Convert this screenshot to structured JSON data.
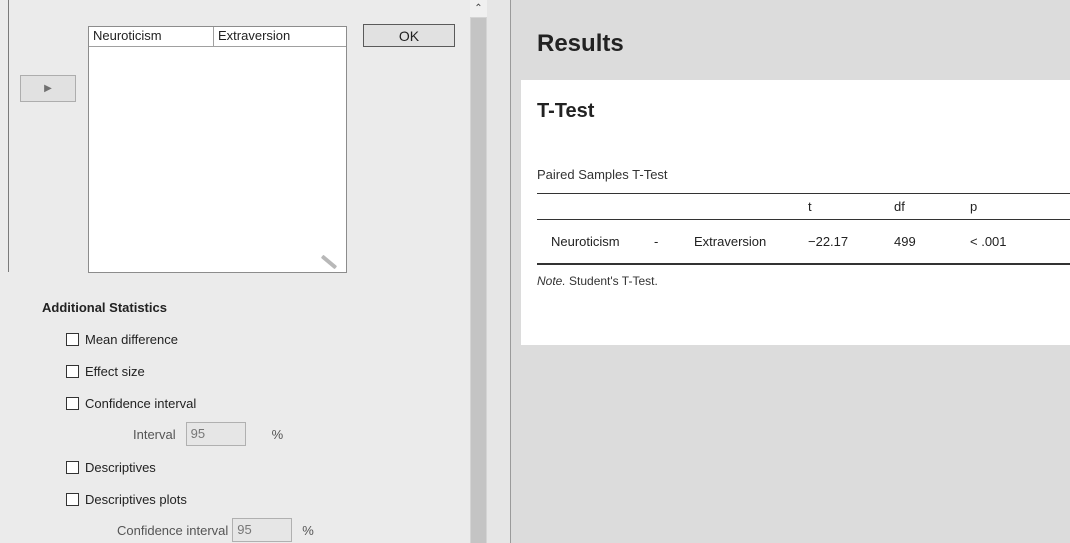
{
  "left_panel": {
    "move_button_icon": "triangle-right-icon",
    "pair_list": {
      "col1": "Neuroticism",
      "col2": "Extraversion"
    },
    "ok_label": "OK",
    "additional_statistics": {
      "title": "Additional Statistics",
      "options": {
        "mean_difference": "Mean difference",
        "effect_size": "Effect size",
        "confidence_interval": "Confidence interval",
        "descriptives": "Descriptives",
        "descriptives_plots": "Descriptives plots"
      },
      "interval_label": "Interval",
      "interval_value": "95",
      "interval_unit": "%",
      "plots_ci_label": "Confidence interval",
      "plots_ci_value": "95",
      "plots_ci_unit": "%"
    }
  },
  "results": {
    "title": "Results",
    "analysis_title": "T-Test",
    "table_caption": "Paired Samples T-Test",
    "headers": {
      "t": "t",
      "df": "df",
      "p": "p"
    },
    "row": {
      "var1": "Neuroticism",
      "sep": "-",
      "var2": "Extraversion",
      "t": "−22.17",
      "df": "499",
      "p": "< .001"
    },
    "note_label": "Note.",
    "note_text": " Student's T-Test."
  }
}
